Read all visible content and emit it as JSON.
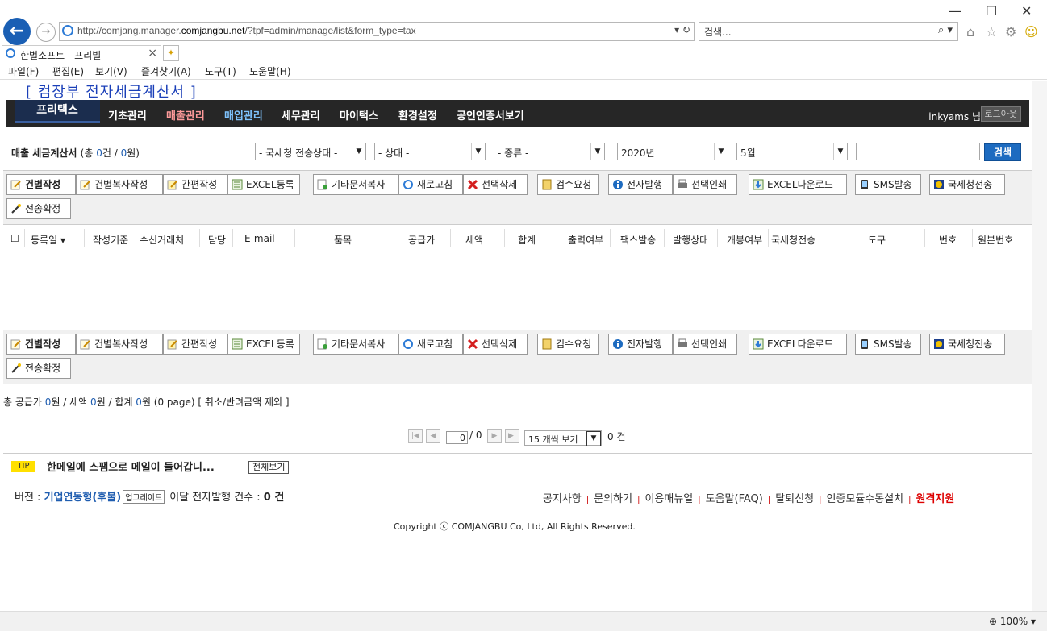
{
  "browser": {
    "url_prefix": "http://comjang.manager.",
    "url_host": "comjangbu.net",
    "url_rest": "/?tpf=admin/manage/list&form_type=tax",
    "search_placeholder": "검색...",
    "tab_title": "한별소프트 - 프리빌",
    "menu": [
      "파일(F)",
      "편집(E)",
      "보기(V)",
      "즐겨찾기(A)",
      "도구(T)",
      "도움말(H)"
    ],
    "zoom": "100%"
  },
  "app": {
    "title": "[ 컴장부 전자세금계산서 ]",
    "brand": "프리택스",
    "nav": [
      "기초관리",
      "매출관리",
      "매입관리",
      "세무관리",
      "마이택스",
      "환경설정",
      "공인인증서보기"
    ],
    "nav_colors": {
      "active_sales": "#ff9b9b",
      "active_purchase": "#7fc4ff",
      "default": "#ffffff"
    },
    "user": "inkyams 님",
    "logout": "로그아웃"
  },
  "filters": {
    "list_title": "매출 세금계산서",
    "count_text_pre": "(총 ",
    "count": "0",
    "count_unit": "건 / ",
    "amount": "0",
    "amount_unit": "원)",
    "nts_status": "- 국세청 전송상태 -",
    "status": "- 상태 -",
    "kind": "- 종류 -",
    "year": "2020년",
    "month": "5월",
    "search_btn": "검색"
  },
  "toolbar": {
    "create": "건별작성",
    "copy_create": "건별복사작성",
    "simple_create": "간편작성",
    "excel_register": "EXCEL등록",
    "other_copy": "기타문서복사",
    "refresh": "새로고침",
    "delete_selected": "선택삭제",
    "review_request": "검수요청",
    "e_issue": "전자발행",
    "print_selected": "선택인쇄",
    "excel_download": "EXCEL다운로드",
    "sms": "SMS발송",
    "nts_send": "국세청전송",
    "confirm_send": "전송확정"
  },
  "grid": {
    "headers": [
      "등록일",
      "작성기준",
      "수신거래처",
      "담당",
      "E-mail",
      "품목",
      "공급가",
      "세액",
      "합계",
      "출력여부",
      "팩스발송",
      "발행상태",
      "개봉여부",
      "국세청전송",
      "도구",
      "번호",
      "원본번호"
    ]
  },
  "summary": {
    "text1": "총 공급가 ",
    "supply": "0",
    "text2": "원 / 세액 ",
    "tax": "0",
    "text3": "원 / 합계 ",
    "total": "0",
    "text4": "원 (0 page)   [ 취소/반려금액 제외 ]"
  },
  "pager": {
    "current": "0",
    "of": "/ 0",
    "per_page": "15 개씩 보기",
    "count": "0 건"
  },
  "tip": {
    "badge": "TIP",
    "text": "한메일에 스팸으로 메일이 들어갑니...",
    "view_all": "전체보기"
  },
  "footer": {
    "version_label": "버전 : ",
    "version": "기업연동형(후불)",
    "upgrade": "업그레이드",
    "monthly": "이달 전자발행 건수 : ",
    "monthly_count": "0 건",
    "links": [
      "공지사항",
      "문의하기",
      "이용매뉴얼",
      "도움말(FAQ)",
      "탈퇴신청",
      "인증모듈수동설치"
    ],
    "remote": "원격지원",
    "copyright": "Copyright ⓒ COMJANGBU Co, Ltd, All Rights Reserved."
  }
}
